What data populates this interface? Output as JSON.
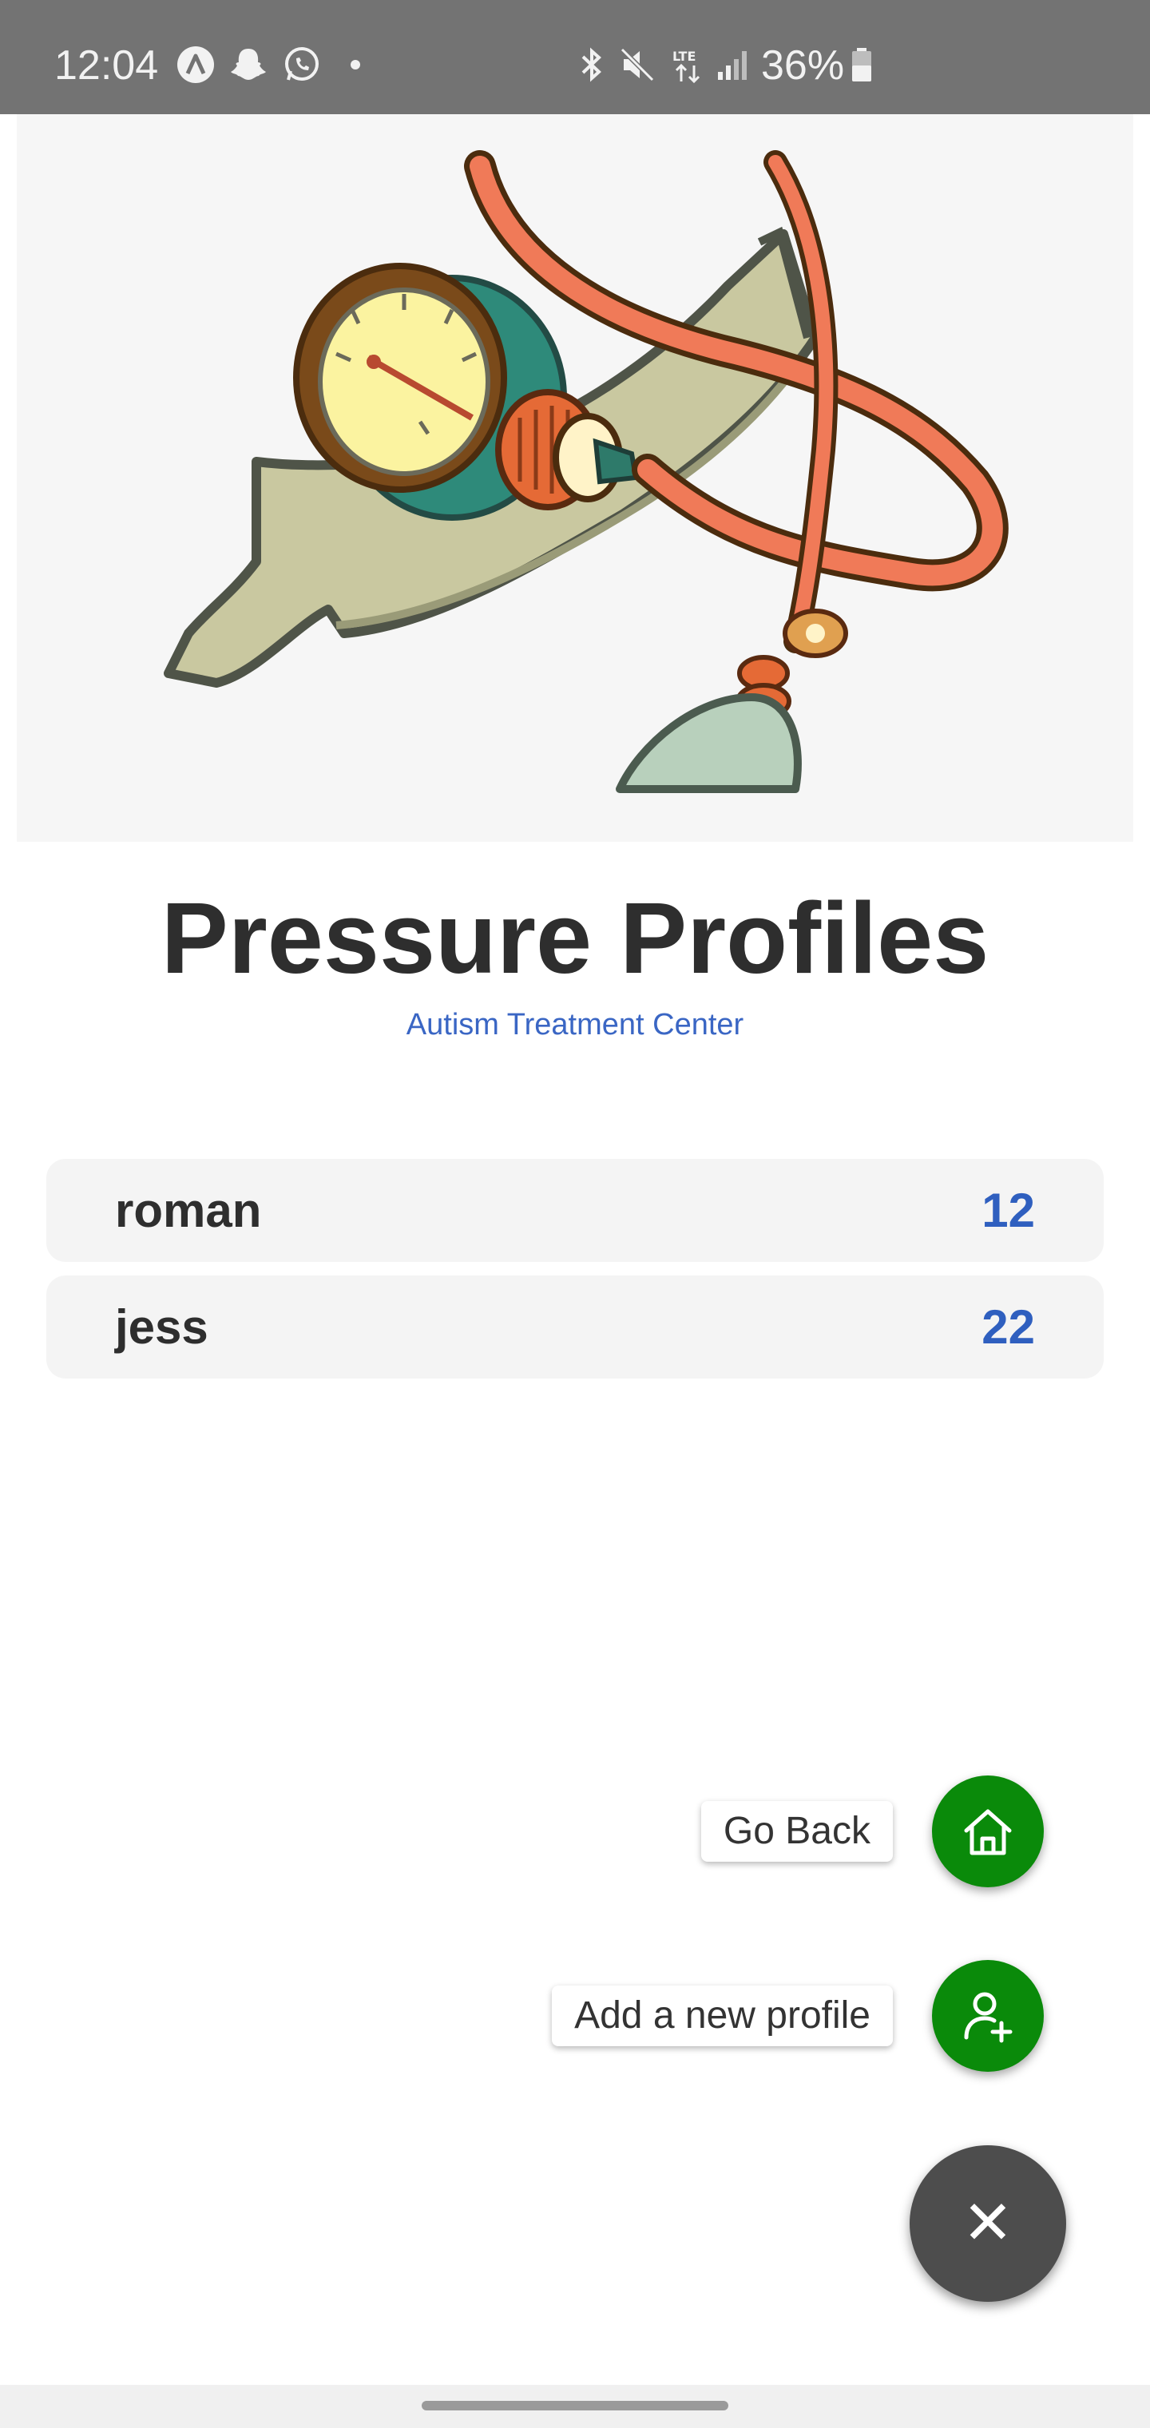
{
  "status_bar": {
    "time": "12:04",
    "battery": "36%",
    "left_icons": [
      "app-a-icon",
      "snapchat-icon",
      "whatsapp-icon",
      "dot-icon"
    ],
    "right_icons": [
      "bluetooth-icon",
      "mute-icon",
      "lte-icon",
      "signal-icon",
      "battery-icon"
    ]
  },
  "hero": {
    "illustration": "blood-pressure-cuff"
  },
  "header": {
    "title": "Pressure Profiles",
    "subtitle": "Autism Treatment Center"
  },
  "profiles": [
    {
      "name": "roman",
      "value": "12"
    },
    {
      "name": "jess",
      "value": "22"
    }
  ],
  "fab_menu": {
    "go_back_label": "Go Back",
    "add_profile_label": "Add a new profile",
    "close_icon": "✕",
    "action_color": "#0a8a0a",
    "main_color": "#4d4d4d"
  },
  "colors": {
    "title": "#2e2e2e",
    "accent_blue": "#2f5fbf",
    "row_bg": "#f4f4f4"
  }
}
